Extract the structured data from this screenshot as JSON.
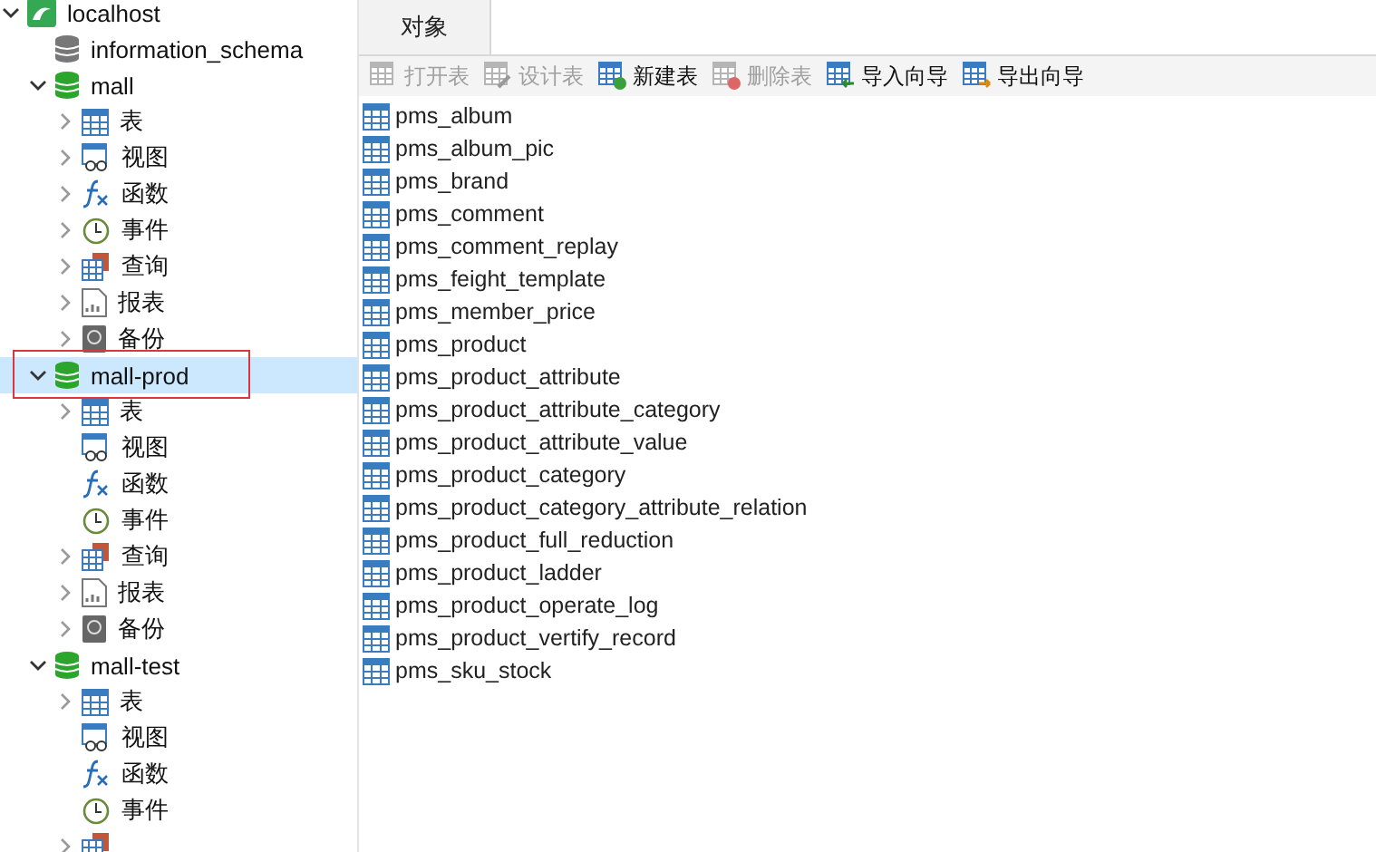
{
  "tree": [
    {
      "label": "localhost",
      "kind": "server",
      "expanded": true,
      "selected": false,
      "annotated": false,
      "children": [
        {
          "label": "information_schema",
          "kind": "db-off",
          "selected": false,
          "annotated": false
        },
        {
          "label": "mall",
          "kind": "db",
          "expanded": true,
          "selected": false,
          "annotated": false,
          "children": [
            {
              "label": "表",
              "kind": "table",
              "expanded": false,
              "selected": false,
              "annotated": false
            },
            {
              "label": "视图",
              "kind": "view",
              "expanded": false,
              "selected": false,
              "annotated": false
            },
            {
              "label": "函数",
              "kind": "function",
              "expanded": false,
              "selected": false,
              "annotated": false
            },
            {
              "label": "事件",
              "kind": "event",
              "expanded": false,
              "selected": false,
              "annotated": false
            },
            {
              "label": "查询",
              "kind": "query",
              "expanded": false,
              "selected": false,
              "annotated": false
            },
            {
              "label": "报表",
              "kind": "report",
              "expanded": false,
              "selected": false,
              "annotated": false
            },
            {
              "label": "备份",
              "kind": "backup",
              "expanded": false,
              "selected": false,
              "annotated": false
            }
          ]
        },
        {
          "label": "mall-prod",
          "kind": "db",
          "expanded": true,
          "selected": true,
          "annotated": true,
          "children": [
            {
              "label": "表",
              "kind": "table",
              "expanded": false,
              "selected": false,
              "annotated": false
            },
            {
              "label": "视图",
              "kind": "view",
              "selected": false,
              "annotated": false
            },
            {
              "label": "函数",
              "kind": "function",
              "selected": false,
              "annotated": false
            },
            {
              "label": "事件",
              "kind": "event",
              "selected": false,
              "annotated": false
            },
            {
              "label": "查询",
              "kind": "query",
              "expanded": false,
              "selected": false,
              "annotated": false
            },
            {
              "label": "报表",
              "kind": "report",
              "expanded": false,
              "selected": false,
              "annotated": false
            },
            {
              "label": "备份",
              "kind": "backup",
              "expanded": false,
              "selected": false,
              "annotated": false
            }
          ]
        },
        {
          "label": "mall-test",
          "kind": "db",
          "expanded": true,
          "selected": false,
          "annotated": false,
          "children": [
            {
              "label": "表",
              "kind": "table",
              "expanded": false,
              "selected": false,
              "annotated": false
            },
            {
              "label": "视图",
              "kind": "view",
              "selected": false,
              "annotated": false
            },
            {
              "label": "函数",
              "kind": "function",
              "selected": false,
              "annotated": false
            },
            {
              "label": "事件",
              "kind": "event",
              "selected": false,
              "annotated": false
            },
            {
              "kind": "query",
              "expanded": false,
              "selected": false,
              "annotated": false
            }
          ]
        }
      ]
    }
  ],
  "tabs": [
    {
      "label": "对象",
      "selected": true
    }
  ],
  "toolbar": [
    {
      "label": "打开表",
      "kind": "open",
      "disabled": true
    },
    {
      "label": "设计表",
      "kind": "design",
      "disabled": true
    },
    {
      "label": "新建表",
      "kind": "new",
      "disabled": false
    },
    {
      "label": "删除表",
      "kind": "delete",
      "disabled": true
    },
    {
      "label": "导入向导",
      "kind": "import",
      "disabled": false
    },
    {
      "label": "导出向导",
      "kind": "export",
      "disabled": false
    }
  ],
  "tables": [
    "pms_album",
    "pms_album_pic",
    "pms_brand",
    "pms_comment",
    "pms_comment_replay",
    "pms_feight_template",
    "pms_member_price",
    "pms_product",
    "pms_product_attribute",
    "pms_product_attribute_category",
    "pms_product_attribute_value",
    "pms_product_category",
    "pms_product_category_attribute_relation",
    "pms_product_full_reduction",
    "pms_product_ladder",
    "pms_product_operate_log",
    "pms_product_vertify_record",
    "pms_sku_stock"
  ]
}
